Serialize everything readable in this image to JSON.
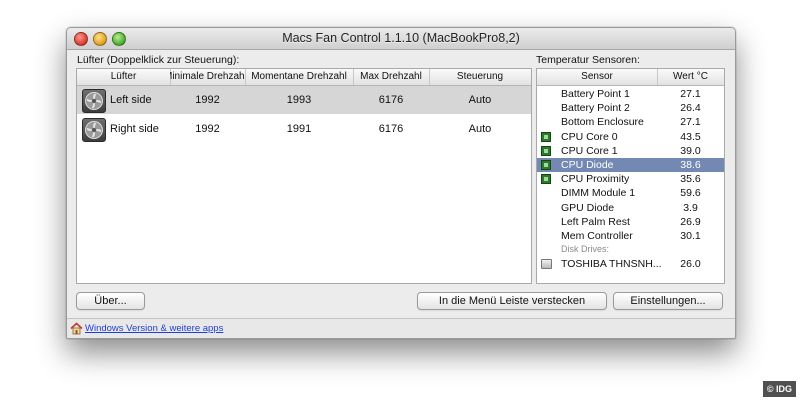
{
  "window": {
    "title": "Macs Fan Control 1.1.10 (MacBookPro8,2)"
  },
  "fans": {
    "section_label": "Lüfter (Doppelklick zur Steuerung):",
    "columns": [
      "Lüfter",
      "Minimale Drehzahl",
      "Momentane Drehzahl",
      "Max Drehzahl",
      "Steuerung"
    ],
    "rows": [
      {
        "icon": "fan-icon",
        "name": "Left side",
        "min": "1992",
        "current": "1993",
        "max": "6176",
        "control": "Auto",
        "selected": true
      },
      {
        "icon": "fan-icon",
        "name": "Right side",
        "min": "1992",
        "current": "1991",
        "max": "6176",
        "control": "Auto",
        "selected": false
      }
    ]
  },
  "sensors": {
    "section_label": "Temperatur Sensoren:",
    "columns": [
      "Sensor",
      "Wert °C"
    ],
    "rows": [
      {
        "name": "Battery Point 1",
        "value": "27.1",
        "icon": ""
      },
      {
        "name": "Battery Point 2",
        "value": "26.4",
        "icon": ""
      },
      {
        "name": "Bottom Enclosure",
        "value": "27.1",
        "icon": ""
      },
      {
        "name": "CPU Core 0",
        "value": "43.5",
        "icon": "chip-icon"
      },
      {
        "name": "CPU Core 1",
        "value": "39.0",
        "icon": "chip-icon"
      },
      {
        "name": "CPU Diode",
        "value": "38.6",
        "icon": "chip-icon",
        "selected": true
      },
      {
        "name": "CPU Proximity",
        "value": "35.6",
        "icon": "chip-icon"
      },
      {
        "name": "DIMM Module 1",
        "value": "59.6",
        "icon": ""
      },
      {
        "name": "GPU Diode",
        "value": "3.9",
        "icon": ""
      },
      {
        "name": "Left Palm Rest",
        "value": "26.9",
        "icon": ""
      },
      {
        "name": "Mem Controller",
        "value": "30.1",
        "icon": ""
      }
    ],
    "group_label": "Disk Drives:",
    "drives": [
      {
        "name": "TOSHIBA THNSNH...",
        "value": "26.0",
        "icon": "drive-icon"
      }
    ]
  },
  "buttons": {
    "about": "Über...",
    "hide_in_menu": "In die Menü Leiste verstecken",
    "settings": "Einstellungen..."
  },
  "footer": {
    "link": "Windows Version & weitere apps",
    "icon": "home-icon"
  },
  "watermark": "© IDG",
  "colors": {
    "selection_sensor": "#7389b4",
    "selection_fan": "#d6d6d6",
    "link": "#1f3fd6",
    "chip": "#2c7a2c"
  }
}
